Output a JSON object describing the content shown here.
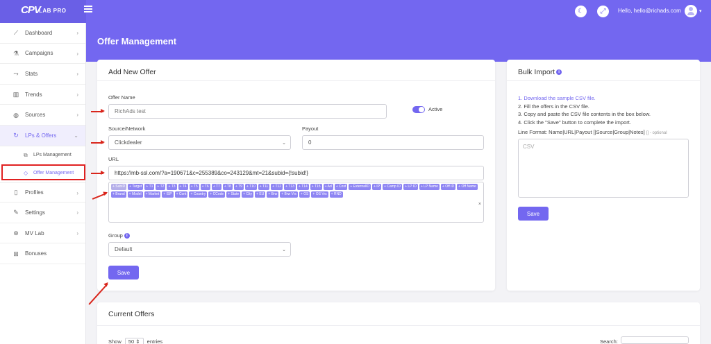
{
  "topbar": {
    "logo_main": "CPV",
    "logo_sub": "LAB PRO",
    "user_greeting": "Hello, hello@richads.com"
  },
  "sidebar": {
    "items": [
      {
        "label": "Dashboard",
        "icon": "chart-line-icon"
      },
      {
        "label": "Campaigns",
        "icon": "flask-icon"
      },
      {
        "label": "Stats",
        "icon": "stats-icon"
      },
      {
        "label": "Trends",
        "icon": "building-icon"
      },
      {
        "label": "Sources",
        "icon": "globe-icon"
      },
      {
        "label": "LPs & Offers",
        "icon": "sync-icon"
      }
    ],
    "subitems": [
      {
        "label": "LPs Management"
      },
      {
        "label": "Offer Management"
      }
    ],
    "items_after": [
      {
        "label": "Profiles"
      },
      {
        "label": "Settings"
      },
      {
        "label": "MV Lab"
      },
      {
        "label": "Bonuses"
      }
    ]
  },
  "page": {
    "title": "Offer Management"
  },
  "add_offer": {
    "title": "Add New Offer",
    "offer_name_label": "Offer Name",
    "offer_name_value": "RichAds test",
    "active_label": "Active",
    "active": true,
    "source_label": "Source/Network",
    "source_value": "Clickdealer",
    "payout_label": "Payout",
    "payout_value": "0",
    "url_label": "URL",
    "url_value": "https://mb-ssl.com/?a=190671&c=255389&co=243129&mt=21&subid={!subid!}",
    "macros": [
      "+ SubID",
      "+ Target",
      "+ T1",
      "+ T2",
      "+ T3",
      "+ T4",
      "+ T5",
      "+ T6",
      "+ T7",
      "+ T8",
      "+ T9",
      "+ T10",
      "+ T11",
      "+ T12",
      "+ T13",
      "+ T14",
      "+ T15",
      "+ Ad",
      "+ Cost",
      "+ ExternalID",
      "+ IP",
      "+ Camp ID",
      "+ LP ID",
      "+ LP Name",
      "+ Off ID",
      "+ Off Name",
      "+ Brand",
      "+ Model",
      "+ Market",
      "+ ISP",
      "+ Cont",
      "+ Country",
      "+ CCode",
      "+ State",
      "+ City",
      "+ EU",
      "+ Brw",
      "+ Brw Vrs",
      "+ OS",
      "+ OS Vrs",
      "+ RND"
    ],
    "group_label": "Group",
    "group_value": "Default",
    "save_label": "Save"
  },
  "bulk_import": {
    "title": "Bulk Import",
    "step1": "1. Download the sample CSV file.",
    "step2": "2. Fill the offers in the CSV file.",
    "step3": "3. Copy and paste the CSV file contents in the box below.",
    "step4": "4. Click the \"Save\" button to complete the import.",
    "line_format": "Line Format: Name|URL|Payout [|Source|Group|Notes]",
    "line_format_optional": "[] - optional",
    "textarea_placeholder": "CSV",
    "save_label": "Save"
  },
  "current_offers": {
    "title": "Current Offers",
    "show_label": "Show",
    "entries_value": "50",
    "entries_label": "entries",
    "search_label": "Search:"
  },
  "colors": {
    "accent": "#7367f0",
    "annotation_red": "#d9261c"
  }
}
